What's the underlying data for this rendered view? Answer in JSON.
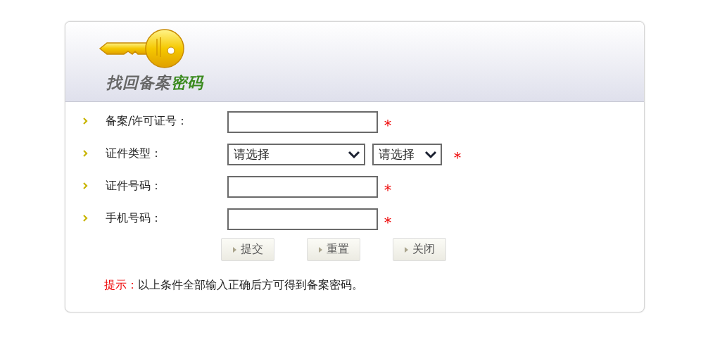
{
  "header": {
    "title": "找回备案",
    "title_highlight": "密码"
  },
  "fields": [
    {
      "kind": "text",
      "label": "备案/许可证号：",
      "required_mark": "*"
    },
    {
      "kind": "select",
      "label": "证件类型：",
      "selects": [
        "请选择",
        "请选择"
      ],
      "required_mark": "*"
    },
    {
      "kind": "text",
      "label": "证件号码：",
      "required_mark": "*"
    },
    {
      "kind": "text",
      "label": "手机号码：",
      "required_mark": "*"
    }
  ],
  "buttons": [
    "提交",
    "重置",
    "关闭"
  ],
  "hint": {
    "label": "提示：",
    "text": "以上条件全部输入正确后方可得到备案密码。"
  }
}
